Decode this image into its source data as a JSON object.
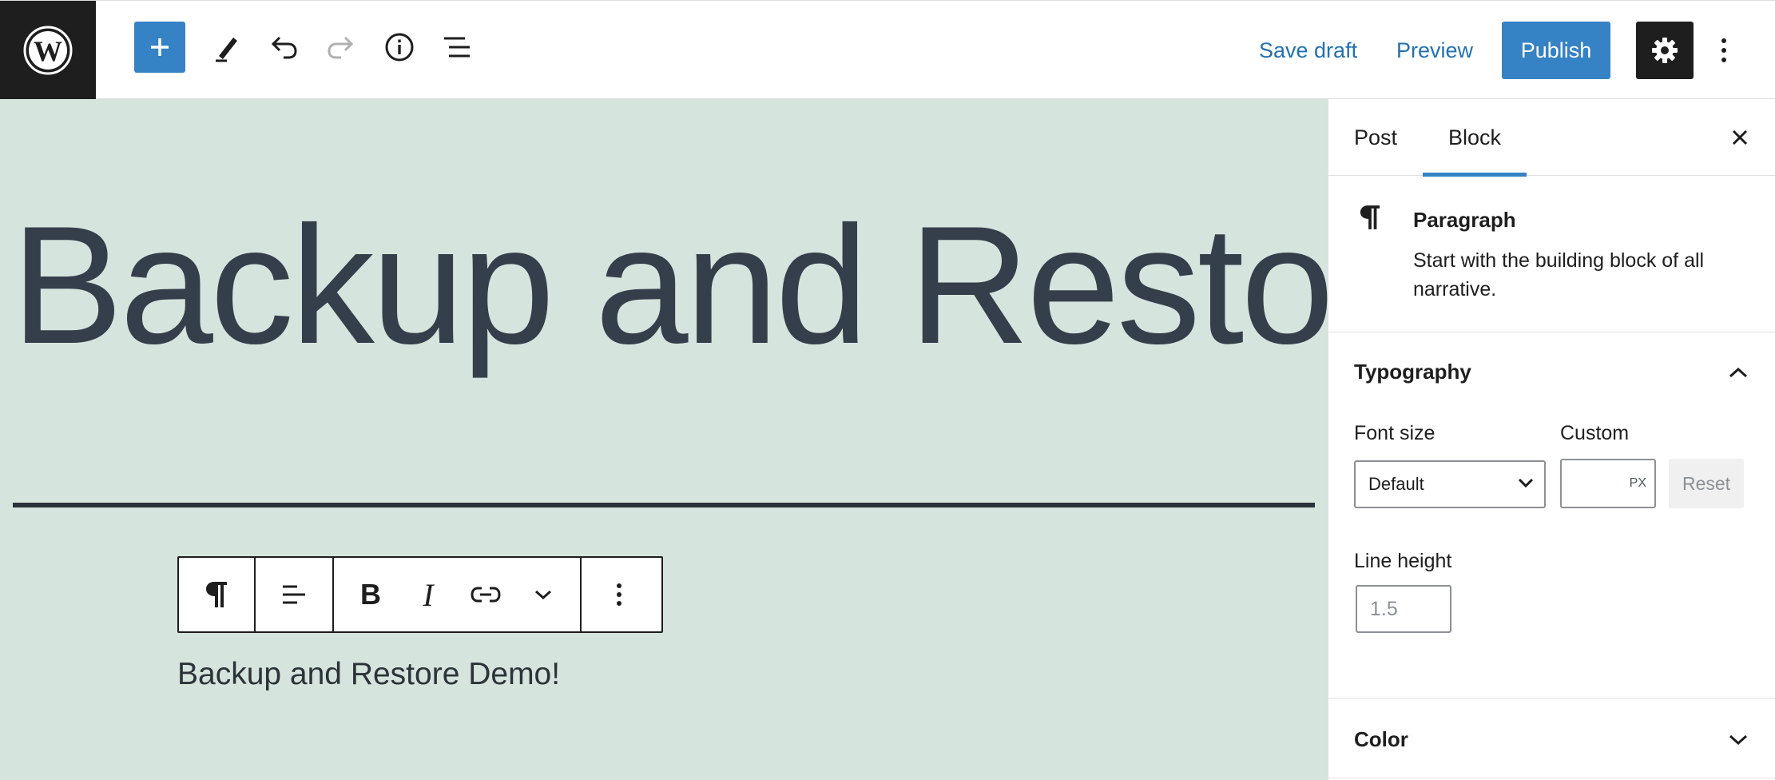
{
  "topbar": {
    "save_draft": "Save draft",
    "preview": "Preview",
    "publish": "Publish"
  },
  "canvas": {
    "title": "Backup and Restore",
    "paragraph": "Backup and Restore Demo!",
    "toolbar": {
      "bold": "B",
      "italic": "I"
    }
  },
  "sidebar": {
    "tabs": [
      {
        "label": "Post",
        "active": false
      },
      {
        "label": "Block",
        "active": true
      }
    ],
    "block_card": {
      "title": "Paragraph",
      "description": "Start with the building block of all narrative."
    },
    "typography": {
      "header": "Typography",
      "font_size_label": "Font size",
      "custom_label": "Custom",
      "font_size_value": "Default",
      "custom_unit": "PX",
      "reset": "Reset",
      "line_height_label": "Line height",
      "line_height_placeholder": "1.5"
    },
    "color": {
      "header": "Color"
    }
  },
  "colors": {
    "accent": "#3582c4",
    "canvas_bg": "#d5e4dd",
    "dark": "#1e1e1e"
  }
}
